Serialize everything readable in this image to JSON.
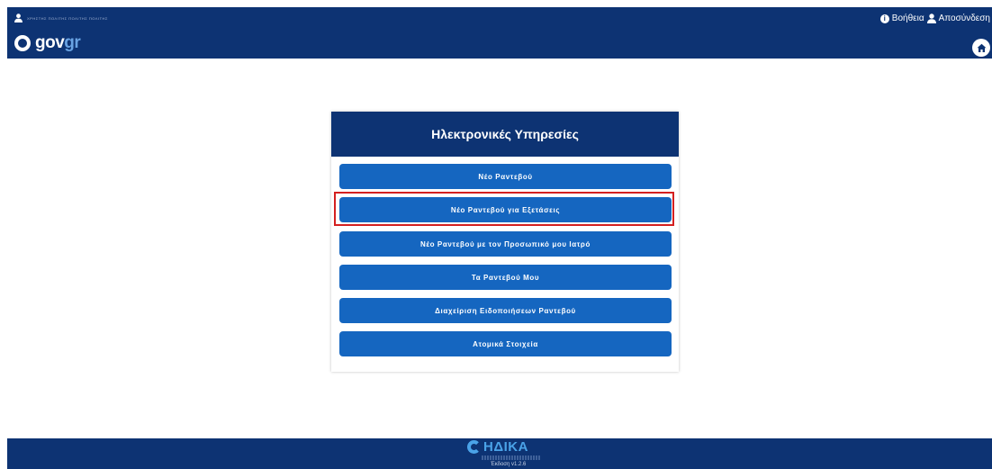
{
  "header": {
    "user_name": "ΧΡΗΣΤΗΣ ΠΟΛΙΤΗΣ ΠΟΛΙΤΗΣ ΠΟΛΙΤΗΣ",
    "logo_gov": "gov",
    "logo_gr": "gr",
    "help_label": "Βοήθεια",
    "logout_label": "Αποσύνδεση",
    "icons": {
      "user": "user-icon",
      "info": "info-icon",
      "home": "home-icon"
    }
  },
  "card": {
    "title": "Ηλεκτρονικές Υπηρεσίες",
    "buttons": [
      {
        "label": "Νέο Ραντεβού"
      },
      {
        "label": "Νέο Ραντεβού για Εξετάσεις",
        "highlighted": true
      },
      {
        "label": "Νέο Ραντεβού με τον Προσωπικό μου Ιατρό"
      },
      {
        "label": "Τα Ραντεβού Μου"
      },
      {
        "label": "Διαχείριση Ειδοποιήσεων Ραντεβού"
      },
      {
        "label": "Ατομικά Στοιχεία"
      }
    ]
  },
  "footer": {
    "brand": "ΗΔΙΚΑ",
    "version": "Έκδοση v1.2.6"
  },
  "colors": {
    "navy": "#0d3373",
    "button_blue": "#1566c0",
    "highlight_red": "#d42020",
    "brand_cyan": "#4aa3e8"
  }
}
